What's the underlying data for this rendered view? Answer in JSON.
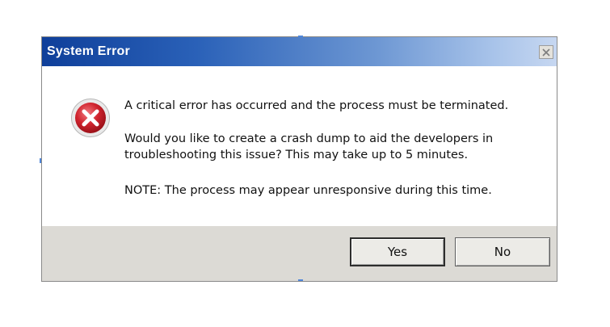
{
  "dialog": {
    "title": "System Error",
    "close_icon": "close-icon",
    "icon": "error-icon",
    "messages": {
      "line1": "A critical error has occurred and the process must be terminated.",
      "line2": "Would you like to create a crash dump to aid the developers in troubleshooting this issue? This may take up to 5 minutes.",
      "line3": "NOTE: The process may appear unresponsive during this time."
    },
    "buttons": {
      "yes": "Yes",
      "no": "No"
    }
  },
  "colors": {
    "titlebar_start": "#0f3f9a",
    "titlebar_end": "#c6d7f1",
    "error_red": "#d0242e",
    "footer_bg": "#dcdad5"
  }
}
